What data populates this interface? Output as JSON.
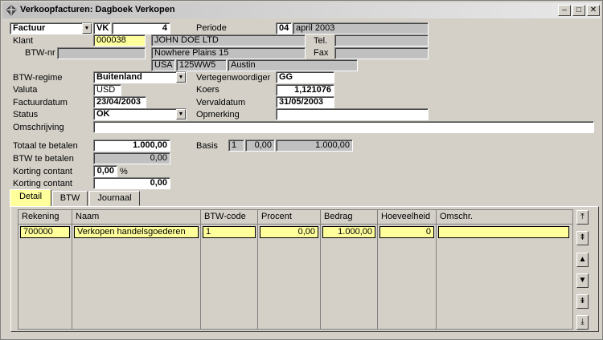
{
  "window": {
    "title": "Verkoopfacturen: Dagboek Verkopen",
    "minimize": "–",
    "maximize": "□",
    "close": "✕"
  },
  "header": {
    "doc_type": "Factuur",
    "journal_code": "VK",
    "number": "4",
    "periode_label": "Periode",
    "periode_num": "04",
    "periode_text": "april 2003",
    "klant_label": "Klant",
    "klant_code": "000038",
    "klant_name": "JOHN DOE LTD",
    "tel_label": "Tel.",
    "tel_value": "",
    "btwnr_label": "BTW-nr",
    "btwnr_value": "",
    "address": "Nowhere Plains 15",
    "fax_label": "Fax",
    "fax_value": "",
    "country": "USA",
    "postcode": "125WW5",
    "city": "Austin"
  },
  "details": {
    "btwregime_label": "BTW-regime",
    "btwregime_value": "Buitenland",
    "rep_label": "Vertegenwoordiger",
    "rep_value": "GG",
    "valuta_label": "Valuta",
    "valuta_value": "USD",
    "koers_label": "Koers",
    "koers_value": "1,121076",
    "factuurdatum_label": "Factuurdatum",
    "factuurdatum_value": "23/04/2003",
    "vervaldatum_label": "Vervaldatum",
    "vervaldatum_value": "31/05/2003",
    "status_label": "Status",
    "status_value": "OK",
    "opmerking_label": "Opmerking",
    "opmerking_value": "",
    "omschrijving_label": "Omschrijving",
    "omschrijving_value": ""
  },
  "totals": {
    "totaal_label": "Totaal te betalen",
    "totaal_value": "1.000,00",
    "btw_label": "BTW te betalen",
    "btw_value": "0,00",
    "korting_pct_label": "Korting contant",
    "korting_pct_value": "0,00",
    "percent_sign": "%",
    "korting_amt_label": "Korting contant",
    "korting_amt_value": "0,00",
    "basis_label": "Basis",
    "basis_1": "1",
    "basis_2": "0,00",
    "basis_3": "1.000,00"
  },
  "tabs": [
    "Detail",
    "BTW",
    "Journaal"
  ],
  "grid": {
    "columns": [
      "Rekening",
      "Naam",
      "BTW-code",
      "Procent",
      "Bedrag",
      "Hoeveelheid",
      "Omschr."
    ],
    "row": {
      "rekening": "700000",
      "naam": "Verkopen handelsgoederen",
      "btwcode": "1",
      "procent": "0,00",
      "bedrag": "1.000,00",
      "hoeveelheid": "0",
      "omschr": ""
    }
  },
  "nav": {
    "first": "⤒",
    "page_up": "⇞",
    "up": "▲",
    "down": "▼",
    "page_down": "⇟",
    "last": "⤓"
  },
  "icons": {
    "app": "diamond-icon",
    "dropdown": "chevron-down-icon"
  }
}
